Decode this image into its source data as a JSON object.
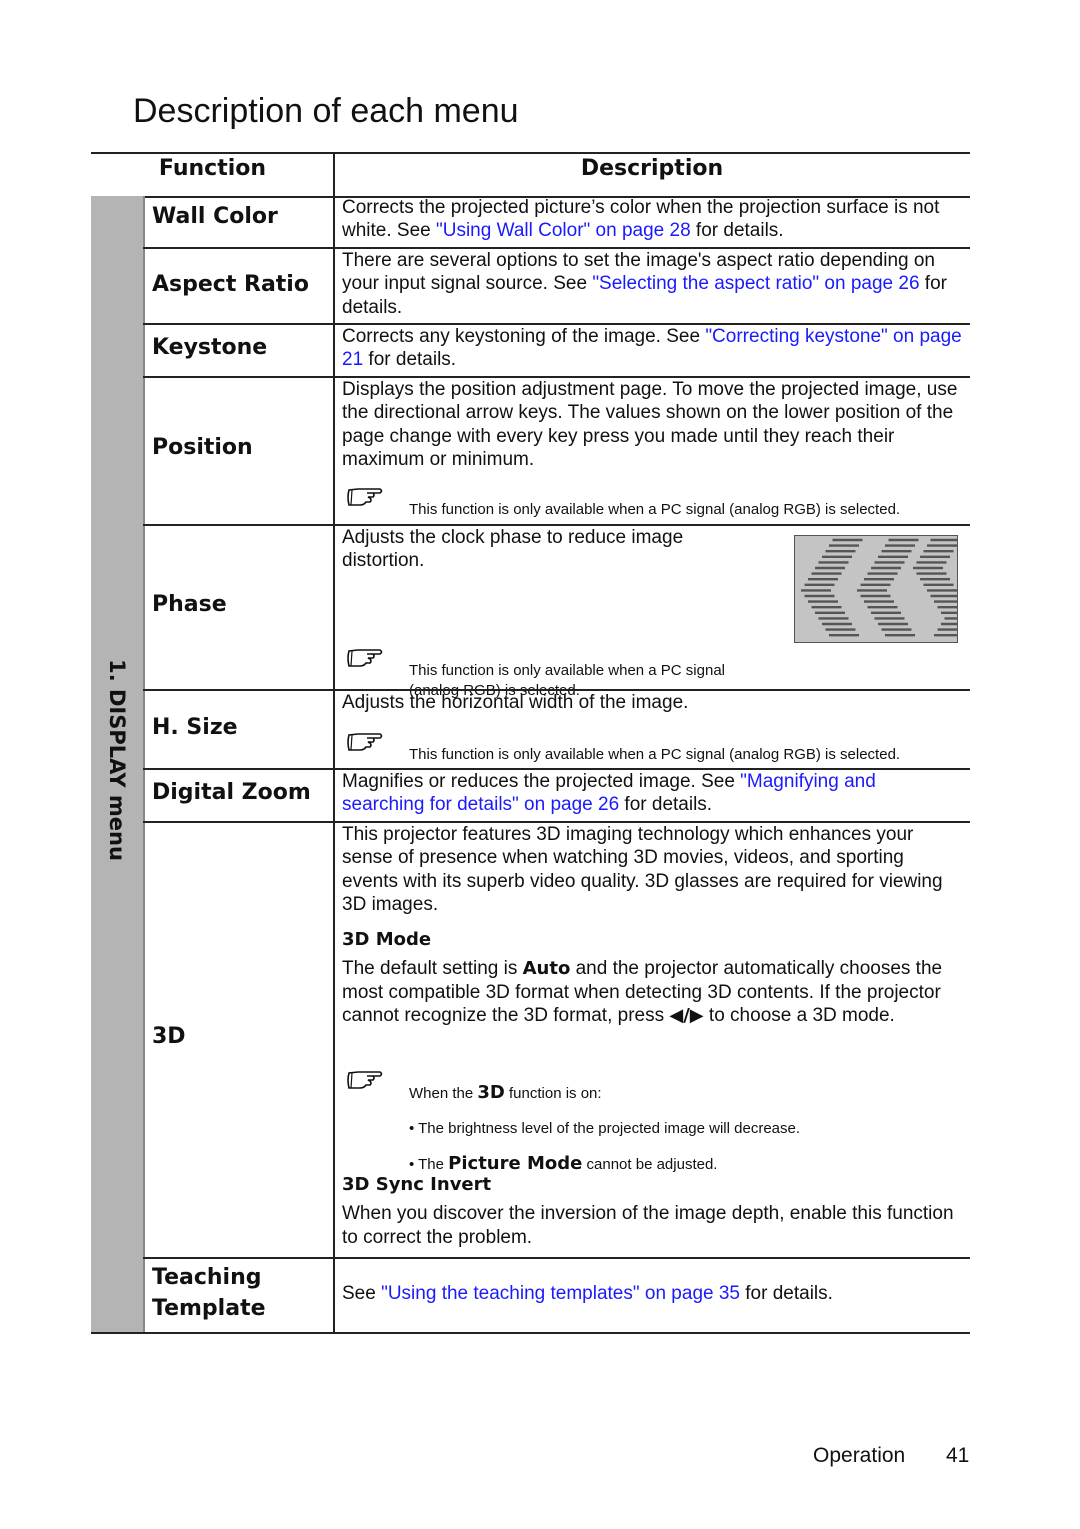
{
  "page_title": "Description of each menu",
  "table": {
    "headers": {
      "function": "Function",
      "description": "Description"
    },
    "side_label": "1. DISPLAY menu",
    "rows": [
      {
        "name": "Wall Color",
        "desc": [
          [
            {
              "t": "Corrects the projected picture’s color when the projection surface is not white. See "
            },
            {
              "t": "\"Using Wall Color\" on page 28",
              "link": true
            },
            {
              "t": " for details."
            }
          ]
        ]
      },
      {
        "name": "Aspect Ratio",
        "desc": [
          [
            {
              "t": "There are several options to set the image's aspect ratio depending on your input signal source. See "
            },
            {
              "t": "\"Selecting the aspect ratio\" on page 26",
              "link": true
            },
            {
              "t": " for details."
            }
          ]
        ]
      },
      {
        "name": "Keystone",
        "desc": [
          [
            {
              "t": "Corrects any keystoning of the image. See "
            },
            {
              "t": "\"Correcting keystone\" on page 21",
              "link": true
            },
            {
              "t": "  for details."
            }
          ]
        ]
      },
      {
        "name": "Position",
        "desc": [
          [
            {
              "t": "Displays the position adjustment page. To move the projected image, use the directional arrow keys. The values shown on the lower position of the page change with every key press you made until they reach their maximum or minimum."
            }
          ]
        ],
        "note": [
          [
            {
              "t": "This function is only available when a PC signal (analog RGB) is selected."
            }
          ]
        ]
      },
      {
        "name": "Phase",
        "desc": [
          [
            {
              "t": "Adjusts the clock phase to reduce image distortion."
            }
          ]
        ],
        "note": [
          [
            {
              "t": "This function is only available when a PC signal (analog RGB) is selected."
            }
          ]
        ]
      },
      {
        "name": "H. Size",
        "desc": [
          [
            {
              "t": "Adjusts the horizontal width of the image."
            }
          ]
        ],
        "note": [
          [
            {
              "t": "This function is only available when a PC signal (analog RGB) is selected."
            }
          ]
        ]
      },
      {
        "name": "Digital Zoom",
        "desc": [
          [
            {
              "t": "Magnifies or reduces the projected image. See "
            },
            {
              "t": "\"Magnifying and searching for details\" on page 26",
              "link": true
            },
            {
              "t": " for details."
            }
          ]
        ]
      },
      {
        "name": "3D",
        "desc": [
          [
            {
              "t": "This projector features 3D imaging technology which enhances your sense of presence when watching 3D movies, videos, and sporting events with its superb video quality. 3D glasses are required for viewing 3D images."
            }
          ],
          [
            {
              "t": "3D Mode",
              "b": true
            }
          ],
          [
            {
              "t": "The default setting is "
            },
            {
              "t": "Auto",
              "b": true
            },
            {
              "t": " and the projector automatically chooses the most compatible 3D format when detecting 3D contents. If the projector cannot recognize the 3D format, press "
            },
            {
              "t": "◀/▶",
              "b": true
            },
            {
              "t": " to choose a 3D mode."
            }
          ]
        ],
        "note": [
          [
            {
              "t": "When the "
            },
            {
              "t": "3D",
              "b": true
            },
            {
              "t": " function is on:"
            }
          ],
          [
            {
              "t": "• The brightness level of the projected image will decrease."
            }
          ],
          [
            {
              "t": "•  The "
            },
            {
              "t": "Picture Mode",
              "b": true
            },
            {
              "t": " cannot be adjusted."
            }
          ]
        ],
        "desc2": [
          [
            {
              "t": "3D Sync Invert",
              "b": true
            }
          ],
          [
            {
              "t": "When you discover the inversion of the image depth, enable this function to correct the problem."
            }
          ]
        ]
      },
      {
        "name": "Teaching Template",
        "desc": [
          [
            {
              "t": "See "
            },
            {
              "t": "\"Using the teaching templates\" on page 35",
              "link": true
            },
            {
              "t": " for details."
            }
          ]
        ]
      }
    ]
  },
  "footer": {
    "section": "Operation",
    "page_number": "41"
  },
  "colors": {
    "link": "#1a1aff",
    "side_band": "#b4b4b4"
  }
}
